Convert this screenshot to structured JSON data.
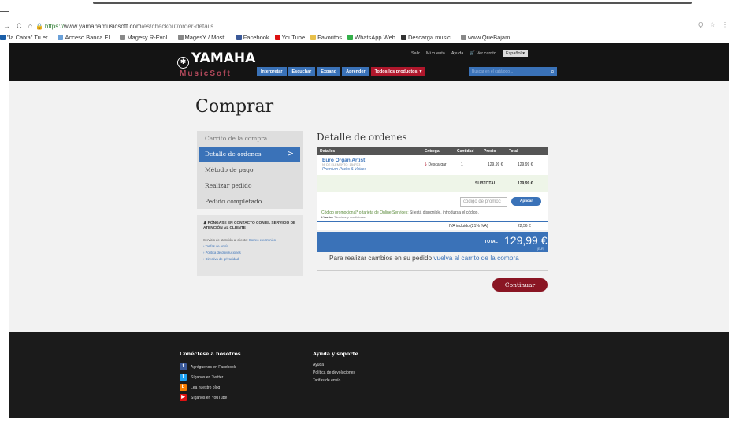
{
  "browser": {
    "url_secure": "https://",
    "url_host": "www.yamahamusicsoft.com",
    "url_path": "/es/checkout/order-details",
    "bookmarks": [
      {
        "label": "\"la Caixa\" Tu er...",
        "color": "#1a5ea8",
        "icon": "bookmark-icon"
      },
      {
        "label": "Acceso Banca El...",
        "color": "#6aa0d8",
        "icon": "bank-icon"
      },
      {
        "label": "Magesy R-Evol...",
        "color": "#888",
        "icon": "page-icon"
      },
      {
        "label": "MagesY / Most ...",
        "color": "#888",
        "icon": "page-icon"
      },
      {
        "label": "Facebook",
        "color": "#3b5998",
        "icon": "facebook-icon"
      },
      {
        "label": "YouTube",
        "color": "#d11",
        "icon": "youtube-icon"
      },
      {
        "label": "Favoritos",
        "color": "#e8c04a",
        "icon": "folder-icon"
      },
      {
        "label": "WhatsApp Web",
        "color": "#34b04a",
        "icon": "whatsapp-icon"
      },
      {
        "label": "Descarga music...",
        "color": "#333",
        "icon": "download-icon"
      },
      {
        "label": "www.QueBajam...",
        "color": "#888",
        "icon": "page-icon"
      }
    ]
  },
  "header": {
    "logo": "YAMAHA",
    "logo_sub": "MusicSoft",
    "top_links": [
      "Salir",
      "Mi cuenta",
      "Ayuda",
      "Ver carrito"
    ],
    "language": "Español",
    "categories": [
      "Interpretar",
      "Escuchar",
      "Expand",
      "Aprender"
    ],
    "all_products": "Todos los productos",
    "search_placeholder": "Buscar en el catálogo..."
  },
  "page": {
    "title": "Comprar",
    "steps": [
      "Carrito de la compra",
      "Detalle de ordenes",
      "Método de pago",
      "Realizar pedido",
      "Pedido completado"
    ],
    "contact": {
      "title": "PÓNGASE EN CONTACTO CON EL SERVICIO DE ATENCIÓN AL CLIENTE",
      "text": "Servicio de atención al cliente:",
      "email": "Correo electrónico",
      "links": [
        "Tarifas de envío",
        "Política de devoluciones",
        "Directiva de privacidad"
      ]
    }
  },
  "order": {
    "title": "Detalle de ordenes",
    "columns": [
      "Detalles",
      "Entrega",
      "Cantidad",
      "Precio",
      "Total"
    ],
    "item": {
      "name": "Euro Organ Artist",
      "number": "Nº DE ELEMENTO: 1B4FD3",
      "category": "Premium Packs & Voices",
      "delivery": "Descargar",
      "qty": "1",
      "price": "129,99 €",
      "total": "129,99 €"
    },
    "subtotal_label": "SUBTOTAL",
    "subtotal": "129,99 €",
    "promo_placeholder": "código de promoc",
    "apply_label": "Aplicar",
    "promo_text_a": "Código promocional* o tarjeta de Online Services:",
    "promo_text_b": " Si está disponible, introduzca el código.",
    "terms_a": "* Ver los",
    "terms_b": " Términos y condiciones",
    "iva_label": "IVA incluido (21% IVA)",
    "iva": "22,56 €",
    "total_label": "TOTAL",
    "total": "129,99 €",
    "total_note": "(EUR)",
    "changes_text": "Para realizar cambios en su pedido",
    "changes_link": "vuelva al carrito de la compra",
    "continue": "Continuar"
  },
  "footer": {
    "connect_title": "Conéctese a nosotros",
    "social": [
      {
        "label": "Agréguenos en Facebook",
        "color": "#3b5998",
        "glyph": "f",
        "icon": "facebook-icon"
      },
      {
        "label": "Síganos en Twitter",
        "color": "#1da1f2",
        "glyph": "t",
        "icon": "twitter-icon"
      },
      {
        "label": "Lea nuestro blog",
        "color": "#f57d00",
        "glyph": "b",
        "icon": "rss-icon"
      },
      {
        "label": "Síganos en YouTube",
        "color": "#d11",
        "glyph": "▶",
        "icon": "youtube-icon"
      }
    ],
    "help_title": "Ayuda y soporte",
    "help_links": [
      "Ayuda",
      "Política de devoluciones",
      "Tarifas de envío"
    ]
  }
}
